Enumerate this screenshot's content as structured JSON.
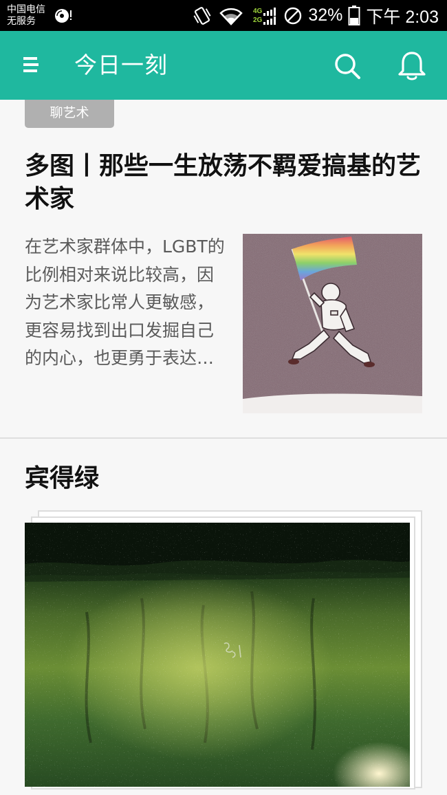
{
  "status_bar": {
    "carrier_line1": "中国电信",
    "carrier_line2": "无服务",
    "net_4g": "4G",
    "net_2g": "2G",
    "battery": "32%",
    "time": "下午 2:03"
  },
  "app_bar": {
    "title": "今日一刻"
  },
  "articles": [
    {
      "tag": "聊艺术",
      "title": "多图丨那些一生放荡不羁爱搞基的艺术家",
      "excerpt": "在艺术家群体中，LGBT的比例相对来说比较高，因为艺术家比常人更敏感，更容易找到出口发掘自己的内心，也更勇于表达…"
    },
    {
      "title": "宾得绿"
    }
  ],
  "colors": {
    "accent": "#1fb89f",
    "status_bar": "#000000",
    "tag_bg": "#b0b0b0",
    "page_bg": "#f7f7f7"
  },
  "icons": {
    "menu": "menu-icon",
    "search": "search-icon",
    "notifications": "bell-icon"
  }
}
